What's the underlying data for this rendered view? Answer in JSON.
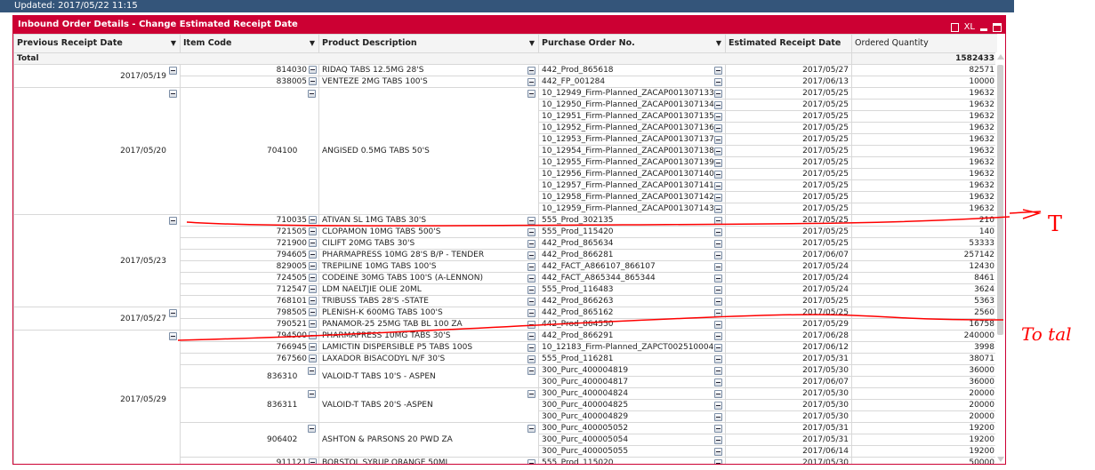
{
  "topbar": {
    "updated": "Updated: 2017/05/22 11:15"
  },
  "panel": {
    "title": "Inbound Order Details - Change Estimated Receipt Date",
    "xl_label": "XL"
  },
  "columns": [
    "Previous Receipt Date",
    "Item Code",
    "Product Description",
    "Purchase Order No.",
    "Estimated Receipt Date",
    "Ordered Quantity"
  ],
  "total": {
    "label": "Total",
    "qty": "1582433"
  },
  "groups": [
    {
      "date": "2017/05/19",
      "items": [
        {
          "code": "814030",
          "desc": "RIDAQ TABS 12.5MG 28'S",
          "orders": [
            {
              "po": "442_Prod_865618",
              "date": "2017/05/27",
              "qty": "82571"
            }
          ]
        },
        {
          "code": "838005",
          "desc": "VENTEZE 2MG TABS 100'S",
          "orders": [
            {
              "po": "442_FP_001284",
              "date": "2017/06/13",
              "qty": "10000"
            }
          ]
        }
      ]
    },
    {
      "date": "2017/05/20",
      "items": [
        {
          "code": "704100",
          "desc": "ANGISED 0.5MG TABS 50'S",
          "orders": [
            {
              "po": "10_12949_Firm-Planned_ZACAP001307133",
              "date": "2017/05/25",
              "qty": "19632"
            },
            {
              "po": "10_12950_Firm-Planned_ZACAP001307134",
              "date": "2017/05/25",
              "qty": "19632"
            },
            {
              "po": "10_12951_Firm-Planned_ZACAP001307135",
              "date": "2017/05/25",
              "qty": "19632"
            },
            {
              "po": "10_12952_Firm-Planned_ZACAP001307136",
              "date": "2017/05/25",
              "qty": "19632"
            },
            {
              "po": "10_12953_Firm-Planned_ZACAP001307137",
              "date": "2017/05/25",
              "qty": "19632"
            },
            {
              "po": "10_12954_Firm-Planned_ZACAP001307138",
              "date": "2017/05/25",
              "qty": "19632"
            },
            {
              "po": "10_12955_Firm-Planned_ZACAP001307139",
              "date": "2017/05/25",
              "qty": "19632"
            },
            {
              "po": "10_12956_Firm-Planned_ZACAP001307140",
              "date": "2017/05/25",
              "qty": "19632"
            },
            {
              "po": "10_12957_Firm-Planned_ZACAP001307141",
              "date": "2017/05/25",
              "qty": "19632"
            },
            {
              "po": "10_12958_Firm-Planned_ZACAP001307142",
              "date": "2017/05/25",
              "qty": "19632"
            },
            {
              "po": "10_12959_Firm-Planned_ZACAP001307143",
              "date": "2017/05/25",
              "qty": "19632"
            }
          ]
        }
      ]
    },
    {
      "date": "2017/05/23",
      "items": [
        {
          "code": "710035",
          "desc": "ATIVAN SL 1MG TABS 30'S",
          "orders": [
            {
              "po": "555_Prod_302135",
              "date": "2017/05/25",
              "qty": "210"
            }
          ]
        },
        {
          "code": "721505",
          "desc": "CLOPAMON 10MG TABS 500'S",
          "orders": [
            {
              "po": "555_Prod_115420",
              "date": "2017/05/25",
              "qty": "140"
            }
          ]
        },
        {
          "code": "721900",
          "desc": "CILIFT 20MG TABS 30'S",
          "orders": [
            {
              "po": "442_Prod_865634",
              "date": "2017/05/25",
              "qty": "53333"
            }
          ]
        },
        {
          "code": "794605",
          "desc": "PHARMAPRESS 10MG 28'S B/P - TENDER",
          "orders": [
            {
              "po": "442_Prod_866281",
              "date": "2017/06/07",
              "qty": "257142"
            }
          ]
        },
        {
          "code": "829005",
          "desc": "TREPILINE 10MG TABS 100'S",
          "orders": [
            {
              "po": "442_FACT_A866107_866107",
              "date": "2017/05/24",
              "qty": "12430"
            }
          ]
        },
        {
          "code": "724505",
          "desc": "CODEINE 30MG TABS 100'S (A-LENNON)",
          "orders": [
            {
              "po": "442_FACT_A865344_865344",
              "date": "2017/05/24",
              "qty": "8461"
            }
          ]
        },
        {
          "code": "712547",
          "desc": "LDM NAELTJIE OLIE 20ML",
          "orders": [
            {
              "po": "555_Prod_116483",
              "date": "2017/05/24",
              "qty": "3624"
            }
          ]
        },
        {
          "code": "768101",
          "desc": "TRIBUSS TABS 28'S -STATE",
          "orders": [
            {
              "po": "442_Prod_866263",
              "date": "2017/05/25",
              "qty": "5363"
            }
          ]
        }
      ]
    },
    {
      "date": "2017/05/27",
      "items": [
        {
          "code": "798505",
          "desc": "PLENISH-K 600MG TABS 100'S",
          "orders": [
            {
              "po": "442_Prod_865162",
              "date": "2017/05/25",
              "qty": "2560"
            }
          ]
        },
        {
          "code": "790521",
          "desc": "PANAMOR-25 25MG TAB BL 100 ZA",
          "orders": [
            {
              "po": "442_Prod_864550",
              "date": "2017/05/29",
              "qty": "16758"
            }
          ]
        }
      ]
    },
    {
      "date": "2017/05/29",
      "items": [
        {
          "code": "794500",
          "desc": "PHARMAPRESS 10MG TABS 30'S",
          "orders": [
            {
              "po": "442_Prod_866291",
              "date": "2017/06/28",
              "qty": "240000"
            }
          ]
        },
        {
          "code": "766945",
          "desc": "LAMICTIN DISPERSIBLE P5 TABS 100S",
          "orders": [
            {
              "po": "10_12183_Firm-Planned_ZAPCT002510004",
              "date": "2017/06/12",
              "qty": "3998"
            }
          ]
        },
        {
          "code": "767560",
          "desc": "LAXADOR BISACODYL N/F 30'S",
          "orders": [
            {
              "po": "555_Prod_116281",
              "date": "2017/05/31",
              "qty": "38071"
            }
          ]
        },
        {
          "code": "836310",
          "desc": "VALOID-T TABS 10'S - ASPEN",
          "orders": [
            {
              "po": "300_Purc_400004819",
              "date": "2017/05/30",
              "qty": "36000"
            },
            {
              "po": "300_Purc_400004817",
              "date": "2017/06/07",
              "qty": "36000"
            }
          ]
        },
        {
          "code": "836311",
          "desc": "VALOID-T TABS 20'S -ASPEN",
          "orders": [
            {
              "po": "300_Purc_400004824",
              "date": "2017/05/30",
              "qty": "20000"
            },
            {
              "po": "300_Purc_400004825",
              "date": "2017/05/30",
              "qty": "20000"
            },
            {
              "po": "300_Purc_400004829",
              "date": "2017/05/30",
              "qty": "20000"
            }
          ]
        },
        {
          "code": "906402",
          "desc": "ASHTON & PARSONS 20 PWD ZA",
          "orders": [
            {
              "po": "300_Purc_400005052",
              "date": "2017/05/31",
              "qty": "19200"
            },
            {
              "po": "300_Purc_400005054",
              "date": "2017/05/31",
              "qty": "19200"
            },
            {
              "po": "300_Purc_400005055",
              "date": "2017/06/14",
              "qty": "19200"
            }
          ]
        },
        {
          "code": "911121",
          "desc": "BORSTOL SYRUP ORANGE 50ML",
          "orders": [
            {
              "po": "555_Prod_115020",
              "date": "2017/05/30",
              "qty": "50000"
            }
          ]
        }
      ]
    }
  ],
  "annotations": {
    "note_1": "T",
    "note_2": "To tal",
    "pen_color": "#ff0000"
  },
  "colors": {
    "title_bar": "#cc0033",
    "top_bar": "#34557a"
  }
}
